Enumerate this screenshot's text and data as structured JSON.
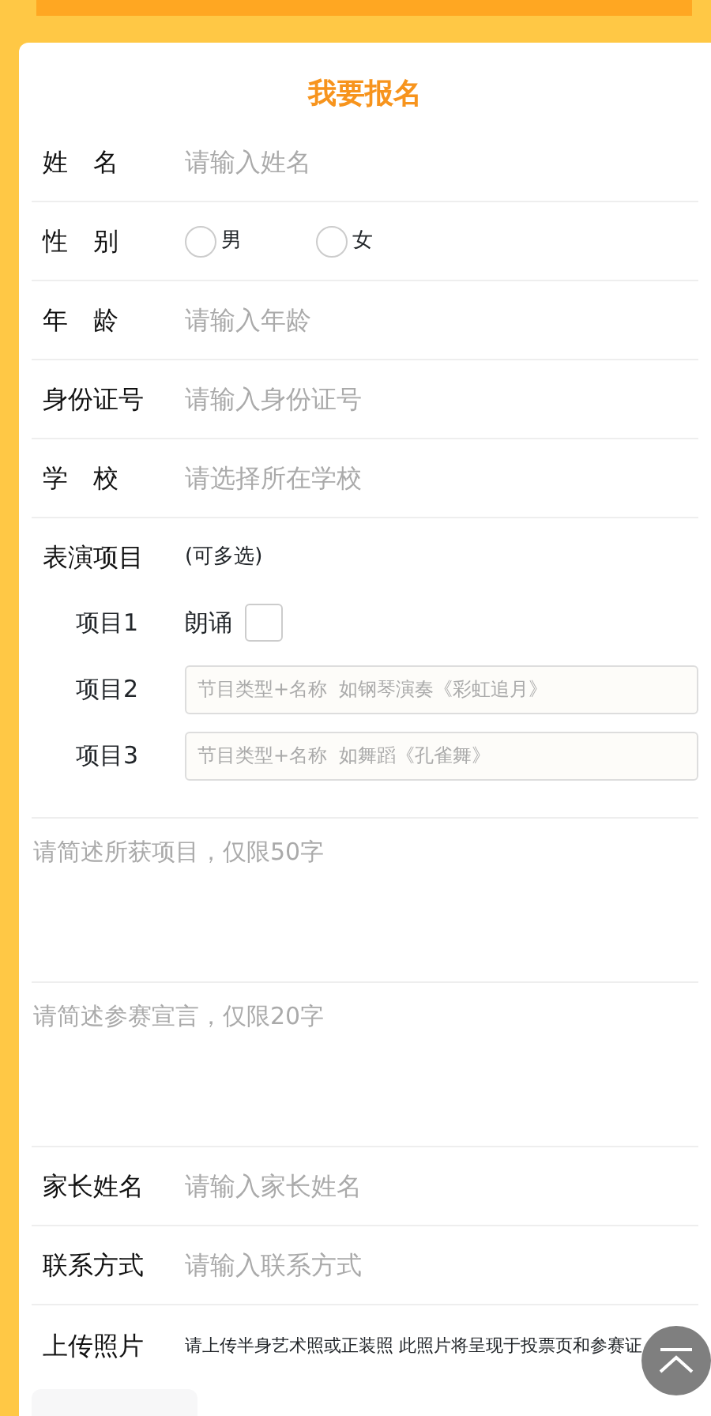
{
  "title": "我要报名",
  "fields": [
    {
      "kind": "text",
      "label": "姓　名",
      "placeholder": "请输入姓名"
    },
    {
      "kind": "radio",
      "label": "性　别",
      "options": [
        {
          "label": "男",
          "selected": false
        },
        {
          "label": "女",
          "selected": false
        }
      ]
    },
    {
      "kind": "text",
      "label": "年　龄",
      "placeholder": "请输入年龄"
    },
    {
      "kind": "text",
      "label": "身份证号",
      "placeholder": "请输入身份证号"
    },
    {
      "kind": "text",
      "label": "学　校",
      "placeholder": "请选择所在学校"
    }
  ],
  "performance": {
    "label": "表演项目",
    "note": "(可多选)",
    "items": [
      {
        "kind": "checkbox",
        "label": "项目1",
        "text": "朗诵",
        "checked": false
      },
      {
        "kind": "input",
        "label": "项目2",
        "placeholder": "节目类型+名称  如钢琴演奏《彩虹追月》"
      },
      {
        "kind": "input",
        "label": "项目3",
        "placeholder": "节目类型+名称  如舞蹈《孔雀舞》"
      }
    ]
  },
  "textareas": [
    {
      "placeholder": "请简述所获项目，仅限50字"
    },
    {
      "placeholder": "请简述参赛宣言，仅限20字"
    }
  ],
  "fields2": [
    {
      "kind": "text",
      "label": "家长姓名",
      "placeholder": "请输入家长姓名"
    },
    {
      "kind": "text",
      "label": "联系方式",
      "placeholder": "请输入联系方式"
    }
  ],
  "upload": {
    "label": "上传照片",
    "hint": "请上传半身艺术照或正装照 此照片将呈现于投票页和参赛证"
  }
}
